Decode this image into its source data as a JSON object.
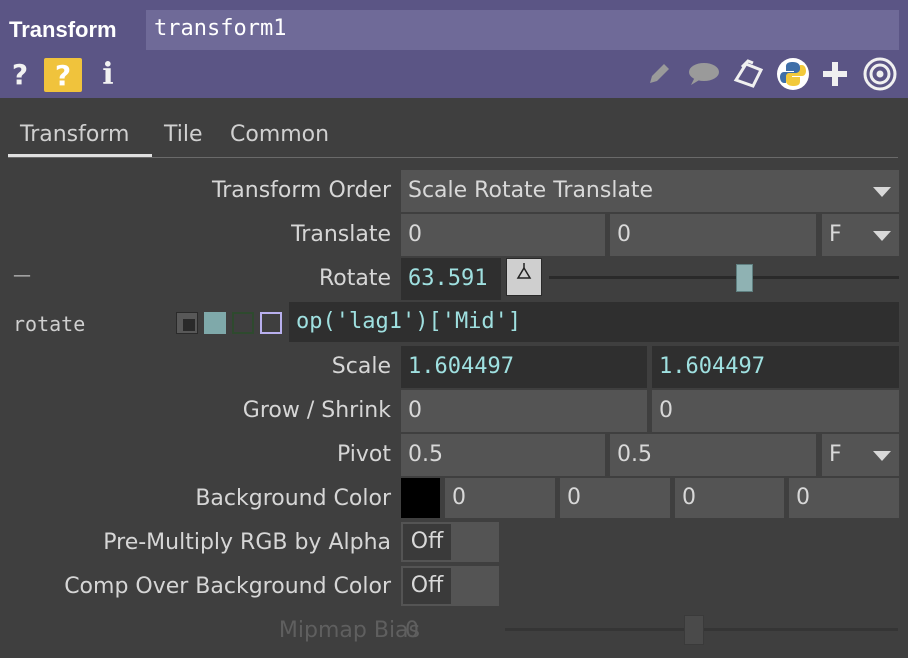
{
  "header": {
    "op_type": "Transform",
    "op_name": "transform1",
    "icons": [
      "help-icon",
      "operator-help-icon",
      "info-icon",
      "edit-icon",
      "comment-icon",
      "clone-icon",
      "python-icon",
      "add-icon",
      "viewer-icon"
    ],
    "help_glyph": "?",
    "op_help_glyph": "?",
    "info_glyph": "i"
  },
  "tabs": [
    {
      "label": "Transform",
      "active": true
    },
    {
      "label": "Tile",
      "active": false
    },
    {
      "label": "Common",
      "active": false
    }
  ],
  "params": {
    "transform_order": {
      "label": "Transform Order",
      "value": "Scale Rotate Translate"
    },
    "translate": {
      "label": "Translate",
      "x": "0",
      "y": "0",
      "unit": "F"
    },
    "rotate": {
      "label": "Rotate",
      "value": "63.591",
      "dash": "—",
      "slider_fraction": 0.56
    },
    "rotate_expr": {
      "name": "rotate",
      "expression": "op('lag1')['Mid']"
    },
    "scale": {
      "label": "Scale",
      "x": "1.604497",
      "y": "1.604497"
    },
    "grow_shrink": {
      "label": "Grow / Shrink",
      "x": "0",
      "y": "0"
    },
    "pivot": {
      "label": "Pivot",
      "x": "0.5",
      "y": "0.5",
      "unit": "F"
    },
    "background_color": {
      "label": "Background Color",
      "r": "0",
      "g": "0",
      "b": "0",
      "a": "0",
      "swatch": "#000000"
    },
    "premultiply": {
      "label": "Pre-Multiply RGB by Alpha",
      "value": "Off"
    },
    "comp_over": {
      "label": "Comp Over Background Color",
      "value": "Off"
    },
    "mipmap_bias": {
      "label": "Mipmap Bias",
      "value": "0",
      "slider_fraction": 0.48
    }
  },
  "colors": {
    "header_bg": "#5b5585",
    "panel_bg": "#3f3f3f",
    "expr_text": "#9fe0e0",
    "op_help_bg": "#f0c33c"
  }
}
